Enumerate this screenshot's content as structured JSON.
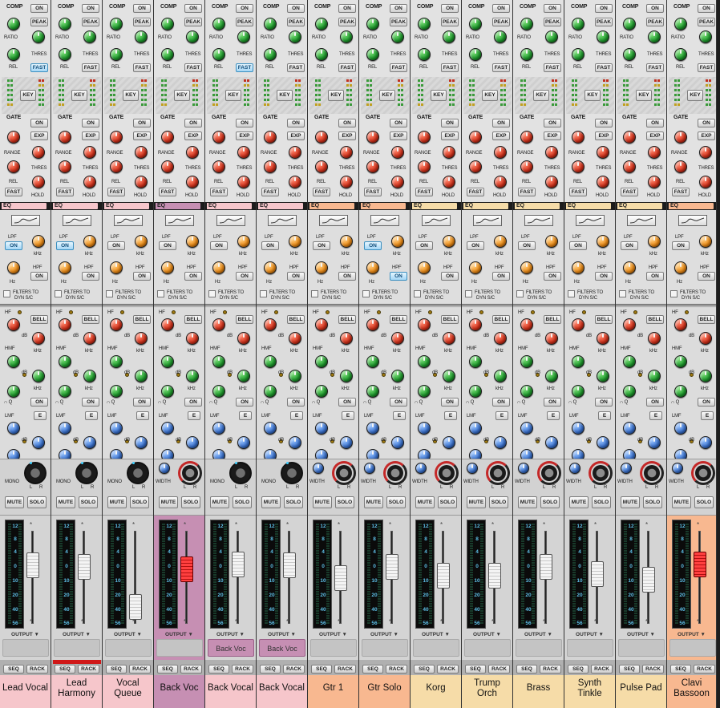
{
  "labels": {
    "comp": "COMP",
    "ratio": "RATIO",
    "thres": "THRES",
    "rel": "REL",
    "gate": "GATE",
    "range": "RANGE",
    "hold": "HOLD",
    "eq": "EQ",
    "lpf": "LPF",
    "hpf": "HPF",
    "khz": "kHz",
    "hz": "Hz",
    "filters_to": "FILTERS TO",
    "dyn_sc": "DYN S/C",
    "hf": "HF",
    "hmf": "HMF",
    "lmf": "LMF",
    "db": "dB",
    "q_symbol": "∩ Q",
    "mono": "MONO",
    "width": "WIDTH",
    "l": "L",
    "r": "R",
    "output": "OUTPUT ▼",
    "star": "*"
  },
  "buttons": {
    "on": "ON",
    "peak": "PEAK",
    "fast": "FAST",
    "key": "KEY",
    "exp": "EXP",
    "bell": "BELL",
    "e": "E",
    "mute": "MUTE",
    "solo": "SOLO",
    "seq": "SEQ",
    "rack": "RACK"
  },
  "meter_scale": [
    "12",
    "8",
    "4",
    "0",
    "10",
    "20",
    "40",
    "56"
  ],
  "channels": [
    {
      "name": "Lead Vocal",
      "color": "#f6c6cb",
      "stereo": false,
      "fast_on": true,
      "lpf_on": true,
      "hpf_on": false,
      "fader_pos": 0.28,
      "fader_red": false,
      "destination": "",
      "selected": false,
      "armed": false
    },
    {
      "name": "Lead\nHarmony",
      "color": "#f6c6cb",
      "stereo": false,
      "fast_on": false,
      "lpf_on": true,
      "hpf_on": false,
      "fader_pos": 0.3,
      "fader_red": false,
      "destination": "",
      "selected": false,
      "armed": true
    },
    {
      "name": "Vocal\nQueue",
      "color": "#f6c6cb",
      "stereo": false,
      "fast_on": false,
      "lpf_on": false,
      "hpf_on": false,
      "fader_pos": 0.78,
      "fader_red": false,
      "destination": "",
      "selected": false,
      "armed": false
    },
    {
      "name": "Back Voc",
      "color": "#c68fb3",
      "stereo": true,
      "fast_on": false,
      "lpf_on": false,
      "hpf_on": false,
      "fader_pos": 0.33,
      "fader_red": true,
      "destination": "",
      "selected": true,
      "armed": false
    },
    {
      "name": "Back Vocal",
      "color": "#f6c6cb",
      "stereo": false,
      "fast_on": true,
      "lpf_on": false,
      "hpf_on": false,
      "fader_pos": 0.27,
      "fader_red": false,
      "destination": "Back Voc",
      "selected": false,
      "armed": false
    },
    {
      "name": "Back Vocal",
      "color": "#f6c6cb",
      "stereo": false,
      "fast_on": false,
      "lpf_on": false,
      "hpf_on": false,
      "fader_pos": 0.28,
      "fader_red": false,
      "destination": "Back Voc",
      "selected": false,
      "armed": false
    },
    {
      "name": "Gtr 1",
      "color": "#f8b890",
      "stereo": true,
      "fast_on": false,
      "lpf_on": false,
      "hpf_on": false,
      "fader_pos": 0.43,
      "fader_red": false,
      "destination": "",
      "selected": false,
      "armed": false
    },
    {
      "name": "Gtr Solo",
      "color": "#f8b890",
      "stereo": true,
      "fast_on": false,
      "lpf_on": true,
      "hpf_on": true,
      "fader_pos": 0.3,
      "fader_red": false,
      "destination": "",
      "selected": false,
      "armed": false
    },
    {
      "name": "Korg",
      "color": "#f6dca8",
      "stereo": true,
      "fast_on": false,
      "lpf_on": false,
      "hpf_on": false,
      "fader_pos": 0.4,
      "fader_red": false,
      "destination": "",
      "selected": false,
      "armed": false
    },
    {
      "name": "Trump\nOrch",
      "color": "#f6dca8",
      "stereo": true,
      "fast_on": false,
      "lpf_on": false,
      "hpf_on": false,
      "fader_pos": 0.4,
      "fader_red": false,
      "destination": "",
      "selected": false,
      "armed": false
    },
    {
      "name": "Brass",
      "color": "#f6dca8",
      "stereo": true,
      "fast_on": false,
      "lpf_on": false,
      "hpf_on": false,
      "fader_pos": 0.3,
      "fader_red": false,
      "destination": "",
      "selected": false,
      "armed": false
    },
    {
      "name": "Synth\nTinkle",
      "color": "#f6dca8",
      "stereo": true,
      "fast_on": false,
      "lpf_on": false,
      "hpf_on": false,
      "fader_pos": 0.38,
      "fader_red": false,
      "destination": "",
      "selected": false,
      "armed": false
    },
    {
      "name": "Pulse Pad",
      "color": "#f6dca8",
      "stereo": true,
      "fast_on": false,
      "lpf_on": false,
      "hpf_on": false,
      "fader_pos": 0.45,
      "fader_red": false,
      "destination": "",
      "selected": false,
      "armed": false
    },
    {
      "name": "Clavi\nBassoon",
      "color": "#f8b890",
      "stereo": true,
      "fast_on": false,
      "lpf_on": false,
      "hpf_on": false,
      "fader_pos": 0.27,
      "fader_red": true,
      "destination": "",
      "selected": true,
      "armed": false
    }
  ]
}
